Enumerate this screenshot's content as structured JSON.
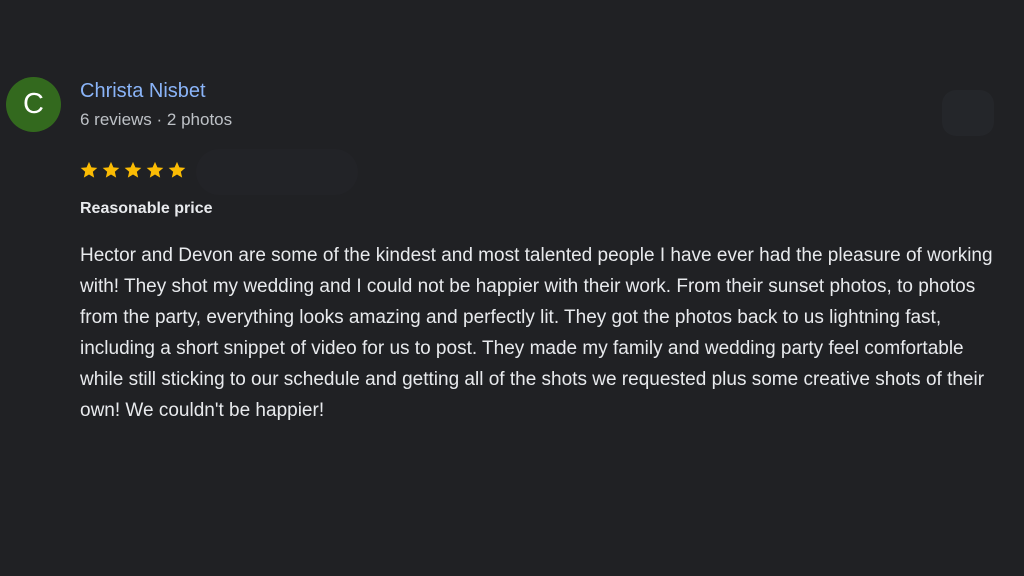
{
  "review": {
    "author": {
      "initial": "C",
      "name": "Christa Nisbet",
      "meta": "6 reviews · 2 photos",
      "avatar_color": "#33691e",
      "name_color": "#8ab4f8"
    },
    "rating": {
      "stars": 5,
      "max": 5,
      "star_color": "#fbbc04"
    },
    "tag": "Reasonable price",
    "text": "Hector and Devon are some of the kindest and most talented people I have ever had the pleasure of working with! They shot my wedding and I could not be happier with their work. From their sunset photos, to photos from the party, everything looks amazing and perfectly lit. They got the photos back to us lightning fast, including a short snippet of video for us to post. They made my family and wedding party feel comfortable while still sticking to our schedule and getting all of the shots we requested plus some creative shots of their own! We couldn't be happier!"
  },
  "theme": {
    "background": "#202124",
    "text_color": "#e8eaed",
    "secondary_text": "#bdc1c6"
  }
}
